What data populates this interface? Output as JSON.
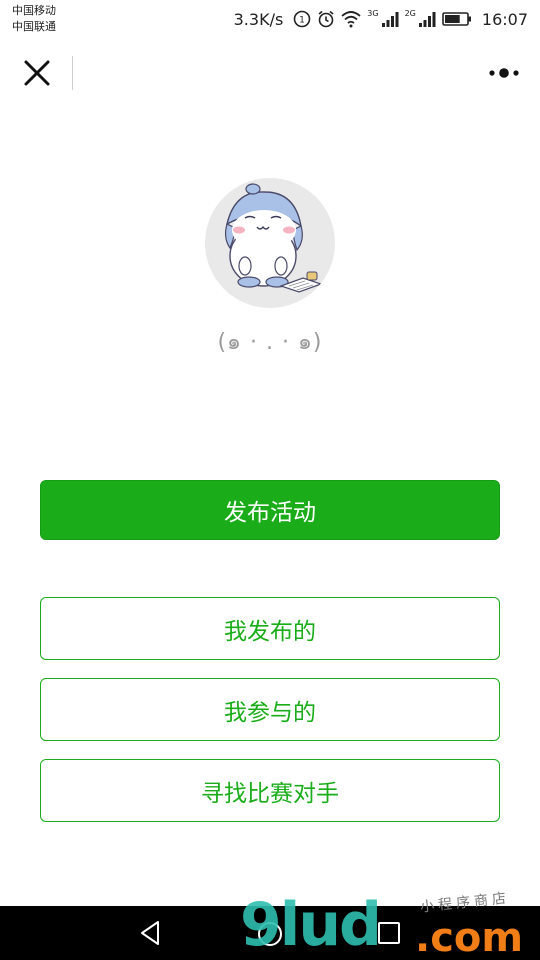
{
  "status_bar": {
    "carrier_1": "中国移动",
    "carrier_2": "中国联通",
    "net_speed": "3.3K/s",
    "net_type_1": "3G",
    "net_type_2": "2G",
    "time": "16:07",
    "icons": [
      "hd-call-icon",
      "alarm-icon",
      "wifi-icon",
      "signal-icon",
      "signal-icon",
      "battery-icon"
    ],
    "battery_level": 0.7
  },
  "navbar": {
    "close_icon": "close-icon",
    "more_icon": "more-dots-icon"
  },
  "profile": {
    "emoticon": "(๑ · . · ๑)"
  },
  "actions": {
    "publish": "发布活动",
    "my_published": "我发布的",
    "my_joined": "我参与的",
    "find_opponent": "寻找比赛对手"
  },
  "colors": {
    "accent": "#1aad19",
    "background": "#ffffff",
    "bottom_nav": "#000000"
  },
  "system_nav": {
    "icons": [
      "back-icon",
      "home-icon",
      "recent-apps-icon"
    ]
  },
  "watermark": {
    "main": "9lud",
    "suffix": ".com",
    "sub": "小程序商店"
  }
}
